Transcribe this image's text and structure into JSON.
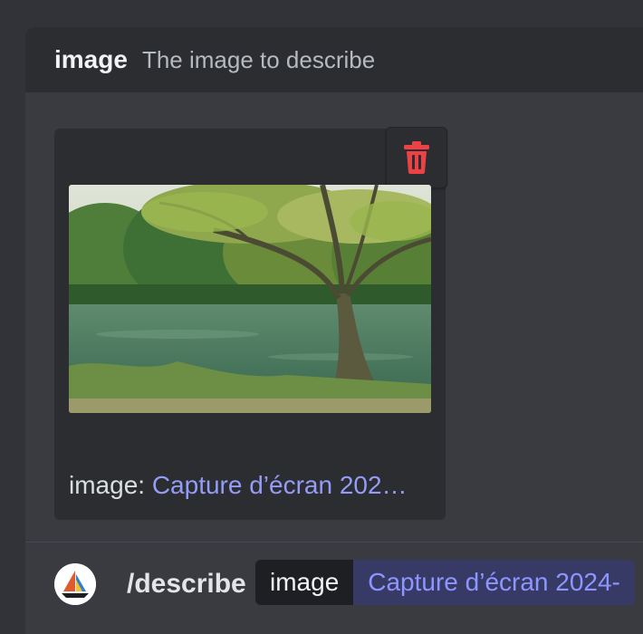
{
  "option": {
    "name": "image",
    "description": "The image to describe"
  },
  "attachment": {
    "label": "image:",
    "filename": "Capture d’écran 202…",
    "thumbnail_alt": "photo"
  },
  "command": {
    "name": "/describe",
    "param_label": "image",
    "param_value": "Capture d’écran 2024-"
  },
  "colors": {
    "delete": "#ed4245",
    "link": "#949cf7"
  },
  "icons": {
    "delete": "trash-icon",
    "bot": "sailboat-icon"
  }
}
